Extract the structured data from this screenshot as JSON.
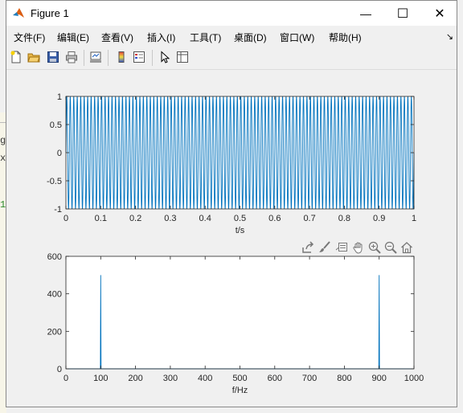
{
  "window": {
    "title": "Figure 1"
  },
  "window_controls": {
    "minimize": "—",
    "maximize": "☐",
    "close": "✕"
  },
  "menu": [
    {
      "label": "文件(F)"
    },
    {
      "label": "编辑(E)"
    },
    {
      "label": "查看(V)"
    },
    {
      "label": "插入(I)"
    },
    {
      "label": "工具(T)"
    },
    {
      "label": "桌面(D)"
    },
    {
      "label": "窗口(W)"
    },
    {
      "label": "帮助(H)"
    }
  ],
  "toolbar_icons": [
    "new-figure-icon",
    "open-file-icon",
    "save-icon",
    "print-icon",
    "link-plot-icon",
    "colorbar-icon",
    "legend-icon",
    "pointer-icon",
    "property-editor-icon"
  ],
  "axes_toolbar_icons": [
    "export-icon",
    "brush-icon",
    "datatip-icon",
    "pan-icon",
    "zoom-in-icon",
    "zoom-out-icon",
    "home-icon"
  ],
  "background_app": {
    "fragments": [
      "g.m",
      "xp",
      "1"
    ]
  },
  "colors": {
    "line": "#0072bd",
    "axes_bg": "#ffffff",
    "figure_bg": "#f0f0f0",
    "axis": "#262626"
  },
  "chart_data": [
    {
      "type": "line",
      "title": "",
      "xlabel": "t/s",
      "ylabel": "",
      "xlim": [
        0,
        1
      ],
      "ylim": [
        -1,
        1
      ],
      "xticks": [
        "0",
        "0.1",
        "0.2",
        "0.3",
        "0.4",
        "0.5",
        "0.6",
        "0.7",
        "0.8",
        "0.9",
        "1"
      ],
      "yticks": [
        "-1",
        "-0.5",
        "0",
        "0.5",
        "1"
      ],
      "signal": {
        "function": "sin",
        "frequency_hz": 100,
        "amplitude": 1,
        "duration_s": 1
      },
      "grid": false
    },
    {
      "type": "line",
      "title": "",
      "xlabel": "f/Hz",
      "ylabel": "",
      "xlim": [
        0,
        1000
      ],
      "ylim": [
        0,
        600
      ],
      "xticks": [
        "0",
        "100",
        "200",
        "300",
        "400",
        "500",
        "600",
        "700",
        "800",
        "900",
        "1000"
      ],
      "yticks": [
        "0",
        "200",
        "400",
        "600"
      ],
      "x": [
        0,
        99,
        100,
        101,
        899,
        900,
        901,
        1000
      ],
      "y": [
        0,
        0,
        500,
        0,
        0,
        500,
        0,
        0
      ],
      "grid": false
    }
  ]
}
